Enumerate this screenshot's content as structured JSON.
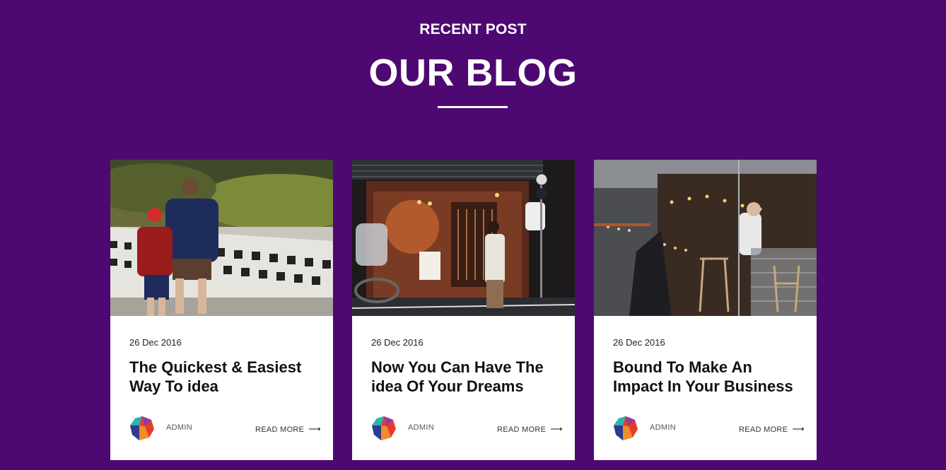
{
  "section": {
    "eyebrow": "RECENT POST",
    "title": "OUR BLOG"
  },
  "posts": [
    {
      "date": "26 Dec 2016",
      "title": "The Quickest & Easiest Way To idea",
      "author": "ADMIN",
      "read_more": "READ MORE",
      "image": "father-and-son-on-bridge-photo"
    },
    {
      "date": "26 Dec 2016",
      "title": "Now You Can Have The idea Of Your Dreams",
      "author": "ADMIN",
      "read_more": "READ MORE",
      "image": "japanese-street-restaurant-photo"
    },
    {
      "date": "26 Dec 2016",
      "title": "Bound To Make An Impact In Your Business",
      "author": "ADMIN",
      "read_more": "READ MORE",
      "image": "cafe-interior-photo"
    }
  ],
  "icons": {
    "arrow": "right-arrow-icon",
    "avatar": "colorful-polygon-avatar"
  },
  "colors": {
    "background": "#4e0872",
    "card": "#ffffff",
    "text": "#111111"
  }
}
